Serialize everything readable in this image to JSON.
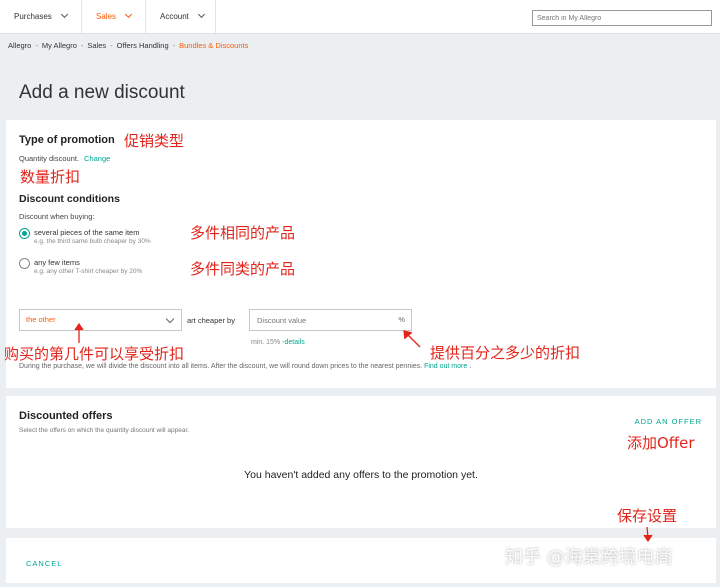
{
  "nav": {
    "items": [
      {
        "label": "Purchases"
      },
      {
        "label": "Sales"
      },
      {
        "label": "Account"
      }
    ],
    "search_placeholder": "Search in My Allegro"
  },
  "breadcrumb": {
    "items": [
      "Allegro",
      "My Allegro",
      "Sales",
      "Offers Handling"
    ],
    "current": "Bundles & Discounts"
  },
  "page": {
    "title": "Add a new discount"
  },
  "promotion": {
    "heading": "Type of promotion",
    "type_text": "Quantity discount.",
    "change_link": "Change"
  },
  "conditions": {
    "heading": "Discount conditions",
    "when_buying": "Discount when buying:",
    "options": [
      {
        "label": "several pieces of the same item",
        "hint": "e.g. the third same bulb cheaper by 30%",
        "checked": true
      },
      {
        "label": "any few items",
        "hint": "e.g. any other T-shirt cheaper by 20%",
        "checked": false
      }
    ],
    "select_value": "the other",
    "cheaper_by": "art cheaper by",
    "discount_placeholder": "Discount value",
    "percent": "%",
    "min_text": "min. 15%",
    "details_link": "-details",
    "during_text": "During the purchase, we will divide the discount into all items. After the discount, we will round down prices to the nearest pennies.",
    "find_out_more": "Find out more",
    "period": "."
  },
  "offers": {
    "heading": "Discounted offers",
    "subtext": "Select the offers on which the quantity discount will appear.",
    "add_offer": "ADD AN OFFER",
    "empty_text": "You haven't added any offers to the promotion yet."
  },
  "footer": {
    "cancel": "CANCEL"
  },
  "annotations": {
    "promo_type": "促销类型",
    "qty_discount": "数量折扣",
    "same_product": "多件相同的产品",
    "similar_product": "多件同类的产品",
    "nth_item": "购买的第几件可以享受折扣",
    "percent_discount": "提供百分之多少的折扣",
    "add_offer": "添加Offer",
    "save_settings": "保存设置"
  },
  "watermark": "知乎 @海棠跨境电商",
  "colors": {
    "accent_orange": "#ff5a00",
    "link_teal": "#00a790",
    "annotation_red": "#e3241b",
    "background": "#eceff1"
  }
}
